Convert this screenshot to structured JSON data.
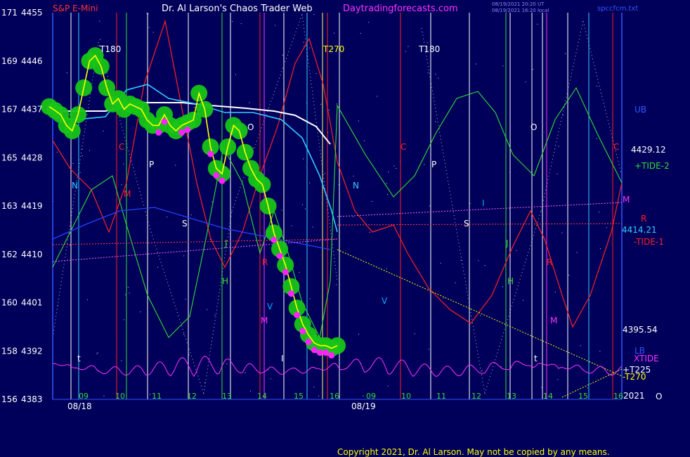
{
  "header": {
    "symbol": "S&P E-Mini",
    "title": "Dr. Al Larson's Chaos Trader Web",
    "site": "Daytradingforecasts.com",
    "stamp1": "08/19/2021 20:20 UT",
    "stamp2": "08/19/2021 16:20 local",
    "file": "spccfcm.txt"
  },
  "footer": {
    "copyright": "Copyright 2021, Dr. Al Larson. May not be copied by any means."
  },
  "colors": {
    "background": "#00005a",
    "price_line": "#ffff00",
    "price_band": "#17c417",
    "dots": "#ff22ff",
    "white_avg": "#ffffff",
    "cyan_avg": "#33ccff",
    "xtide": "#ff33ff",
    "tide_plus": "#33dd33",
    "tide_minus": "#ff2222"
  },
  "chart_data": {
    "type": "line",
    "title": "S&P E-Mini",
    "y_right_ticks": [
      {
        "label": "171",
        "value": 4455
      },
      {
        "label": "169",
        "value": 4446
      },
      {
        "label": "167",
        "value": 4437
      },
      {
        "label": "165",
        "value": 4428
      },
      {
        "label": "163",
        "value": 4419
      },
      {
        "label": "162",
        "value": 4410
      },
      {
        "label": "160",
        "value": 4401
      },
      {
        "label": "158",
        "value": 4392
      },
      {
        "label": "156",
        "value": 4383
      }
    ],
    "ylim": [
      4383,
      4455
    ],
    "x_hours": [
      "09",
      "10",
      "11",
      "12",
      "13",
      "14",
      "15",
      "16",
      "09",
      "10",
      "11",
      "12",
      "13",
      "14",
      "15",
      "16"
    ],
    "dates": [
      "08/18",
      "08/19"
    ],
    "year": "2021",
    "price": {
      "x": [
        0,
        1,
        2,
        3,
        4,
        5,
        6,
        7,
        8,
        9,
        10,
        11,
        12,
        13,
        14,
        15,
        16,
        17,
        18,
        19,
        20,
        21,
        22,
        23,
        24,
        25,
        26,
        27,
        28,
        29,
        30,
        31,
        32,
        33,
        34,
        35,
        36,
        37,
        38,
        39,
        40,
        41,
        42,
        43,
        44,
        45,
        46,
        47,
        48,
        49,
        50
      ],
      "y": [
        4437.5,
        4436.8,
        4436,
        4434,
        4433,
        4436,
        4441,
        4446,
        4447,
        4445,
        4441,
        4438,
        4439,
        4437,
        4438,
        4437.5,
        4437,
        4435,
        4434,
        4434,
        4436,
        4434,
        4433,
        4434,
        4434.5,
        4435,
        4440,
        4437,
        4430,
        4426,
        4425,
        4430,
        4434,
        4433,
        4429,
        4426,
        4424,
        4423,
        4419,
        4414,
        4411,
        4408,
        4404,
        4400,
        4397,
        4395,
        4393.5,
        4393,
        4393,
        4392.5,
        4393
      ]
    },
    "annotations": [
      "T180",
      "T270",
      "T180",
      "C",
      "P",
      "N",
      "S",
      "M",
      "J",
      "H",
      "R",
      "O",
      "V",
      "t",
      "I",
      "C",
      "P",
      "N",
      "S",
      "M",
      "J",
      "H",
      "R",
      "O",
      "V",
      "t",
      "I",
      "UB",
      "LB",
      "+T225",
      "-T270"
    ],
    "right_labels": {
      "v1": "4429.12",
      "v1_name": "+TIDE-2",
      "v2": "4414.21",
      "v2_name": "-TIDE-1",
      "v3": "4395.54",
      "m": "M",
      "r": "R",
      "xtide": "XTIDE",
      "c": "C",
      "o": "O"
    }
  }
}
